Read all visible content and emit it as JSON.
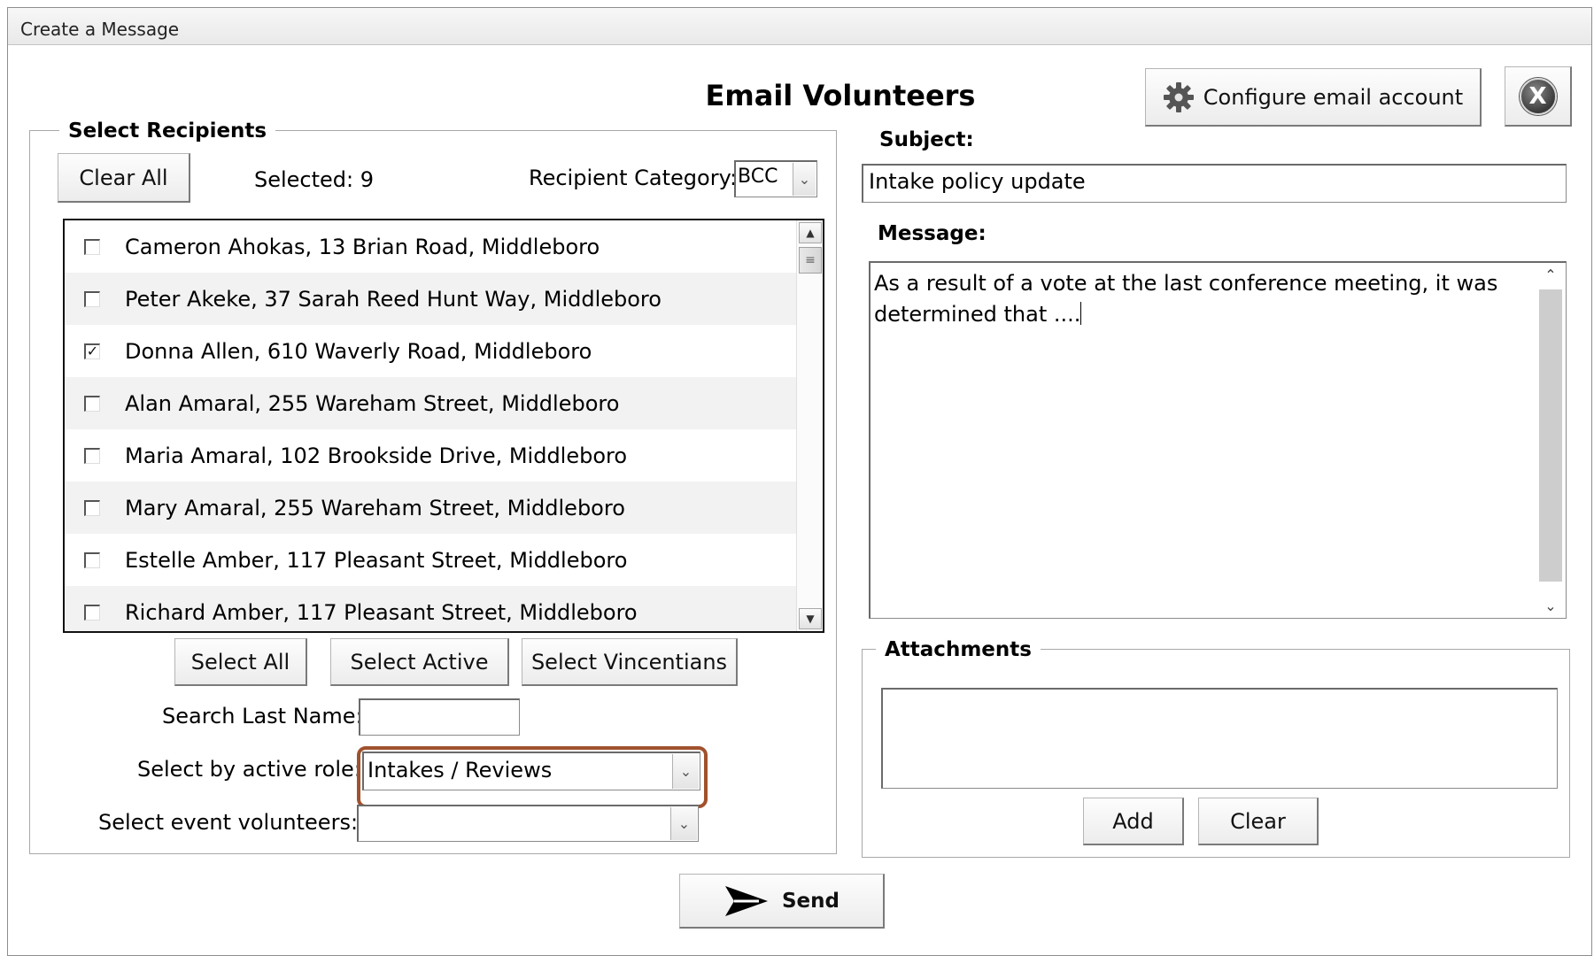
{
  "window": {
    "title": "Create a Message"
  },
  "header": {
    "form_title": "Email Volunteers",
    "configure_label": "Configure email account",
    "close_label": "X"
  },
  "recipients": {
    "group_label": "Select Recipients",
    "clear_all_label": "Clear All",
    "selected_text": "Selected: 9",
    "category_label": "Recipient Category:",
    "category_value": "BCC",
    "rows": [
      {
        "label": "Cameron Ahokas, 13 Brian Road, Middleboro",
        "checked": false
      },
      {
        "label": "Peter Akeke, 37 Sarah Reed Hunt Way, Middleboro",
        "checked": false
      },
      {
        "label": "Donna Allen, 610 Waverly Road, Middleboro",
        "checked": true
      },
      {
        "label": "Alan Amaral, 255 Wareham Street, Middleboro",
        "checked": false
      },
      {
        "label": "Maria Amaral, 102 Brookside Drive, Middleboro",
        "checked": false
      },
      {
        "label": "Mary Amaral, 255 Wareham Street, Middleboro",
        "checked": false
      },
      {
        "label": "Estelle Amber, 117 Pleasant Street, Middleboro",
        "checked": false
      },
      {
        "label": "Richard Amber, 117 Pleasant Street, Middleboro",
        "checked": false
      }
    ],
    "select_all_label": "Select All",
    "select_active_label": "Select Active",
    "select_vincentians_label": "Select Vincentians",
    "search_label": "Search Last Name:",
    "search_value": "",
    "role_label": "Select by active role:",
    "role_value": "Intakes / Reviews",
    "event_label": "Select event volunteers:",
    "event_value": ""
  },
  "compose": {
    "subject_label": "Subject:",
    "subject_value": "Intake policy update",
    "message_label": "Message:",
    "message_value": "As a result of a vote at the last conference meeting, it was determined that ....",
    "attachments_label": "Attachments",
    "add_label": "Add",
    "clear_label": "Clear"
  },
  "footer": {
    "send_label": "Send"
  },
  "colors": {
    "highlight": "#a0522d"
  }
}
